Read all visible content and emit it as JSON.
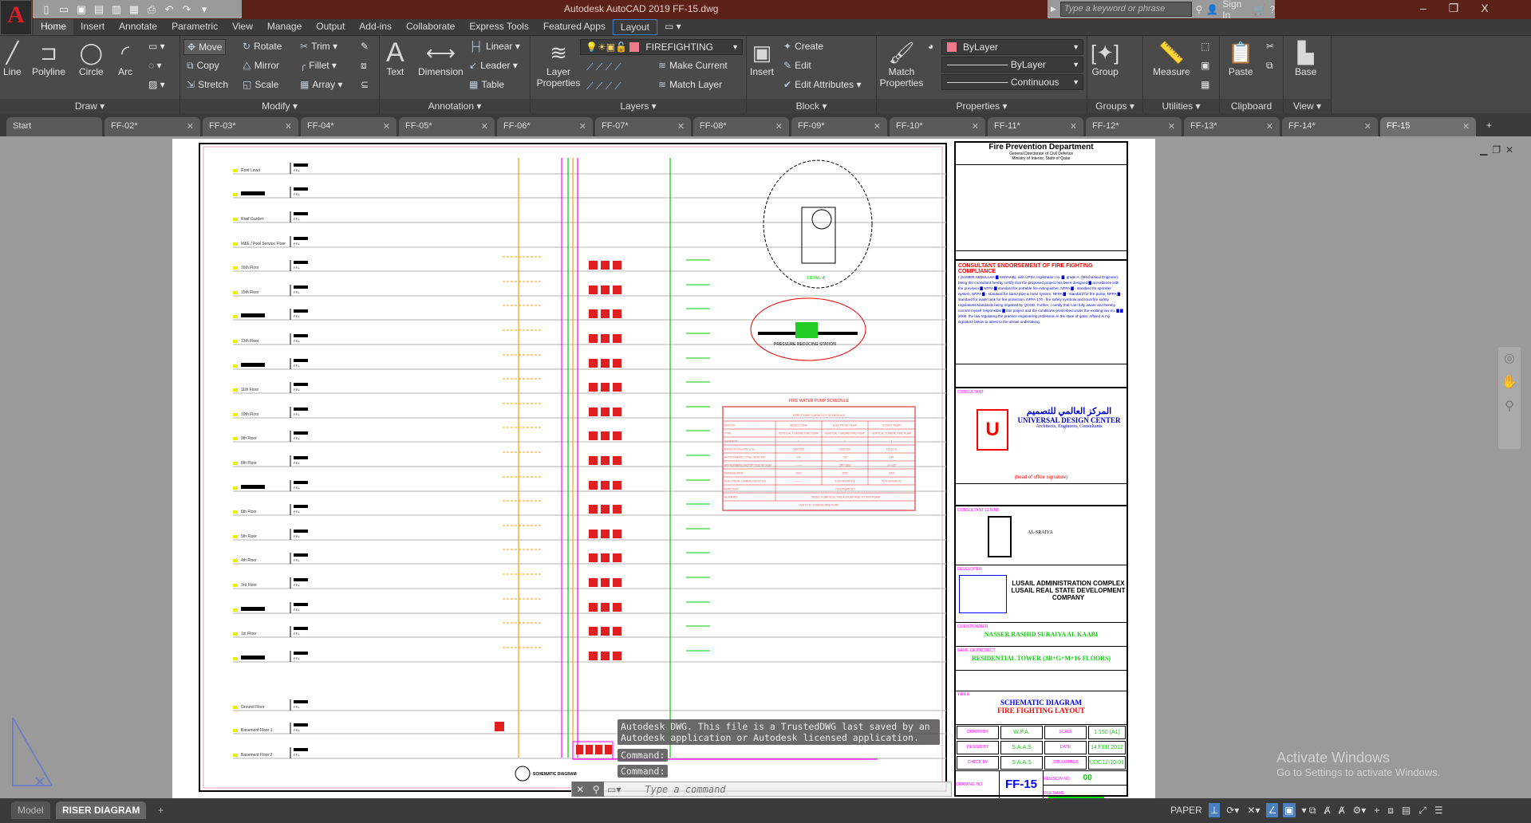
{
  "app": {
    "title": "Autodesk AutoCAD 2019    FF-15.dwg",
    "logo": "A"
  },
  "qat": [
    "new-icon",
    "open-icon",
    "save-icon",
    "save-as-icon",
    "open-web-icon",
    "save-web-icon",
    "plot-icon",
    "undo-icon",
    "redo-icon",
    "customize-icon"
  ],
  "search": {
    "placeholder": "Type a keyword or phrase",
    "sign_in": "Sign In"
  },
  "window": {
    "minimize": "–",
    "restore": "❐",
    "close": "X"
  },
  "ribbon_tabs": [
    "Home",
    "Insert",
    "Annotate",
    "Parametric",
    "View",
    "Manage",
    "Output",
    "Add-ins",
    "Collaborate",
    "Express Tools",
    "Featured Apps",
    "Layout",
    "▭ ▾"
  ],
  "ribbon": {
    "draw": {
      "title": "Draw ▾",
      "line": "Line",
      "polyline": "Polyline",
      "circle": "Circle",
      "arc": "Arc"
    },
    "modify": {
      "title": "Modify ▾",
      "move": "Move",
      "rotate": "Rotate",
      "trim": "Trim",
      "copy": "Copy",
      "mirror": "Mirror",
      "fillet": "Fillet",
      "stretch": "Stretch",
      "scale": "Scale",
      "array": "Array"
    },
    "annotation": {
      "title": "Annotation ▾",
      "text": "Text",
      "dimension": "Dimension",
      "linear": "Linear",
      "leader": "Leader",
      "table": "Table"
    },
    "layers": {
      "title": "Layers ▾",
      "layer_properties": "Layer Properties",
      "current_layer": "FIREFIGHTING",
      "make_current": "Make Current",
      "match_layer": "Match Layer"
    },
    "block": {
      "title": "Block ▾",
      "insert": "Insert",
      "create": "Create",
      "edit": "Edit",
      "edit_attributes": "Edit Attributes"
    },
    "properties": {
      "title": "Properties ▾",
      "match_properties": "Match Properties",
      "color": "ByLayer",
      "lineweight": "ByLayer",
      "linetype": "Continuous"
    },
    "groups": {
      "title": "Groups ▾",
      "group": "Group"
    },
    "utilities": {
      "title": "Utilities ▾",
      "measure": "Measure"
    },
    "clipboard": {
      "title": "Clipboard",
      "paste": "Paste"
    },
    "view": {
      "title": "View ▾",
      "base": "Base"
    }
  },
  "colors": {
    "layer_color": "#f07a8a",
    "title_bar": "#5c2117"
  },
  "file_tabs": [
    {
      "label": "Start"
    },
    {
      "label": "FF-02*"
    },
    {
      "label": "FF-03*"
    },
    {
      "label": "FF-04*"
    },
    {
      "label": "FF-05*"
    },
    {
      "label": "FF-06*"
    },
    {
      "label": "FF-07*"
    },
    {
      "label": "FF-08*"
    },
    {
      "label": "FF-09*"
    },
    {
      "label": "FF-10*"
    },
    {
      "label": "FF-11*"
    },
    {
      "label": "FF-12*"
    },
    {
      "label": "FF-13*"
    },
    {
      "label": "FF-14*"
    },
    {
      "label": "FF-15",
      "active": true
    }
  ],
  "drawing": {
    "floors": [
      "Roof Level",
      "",
      "Roof Garden",
      "M&E / Pool Service Floor",
      "16th Floor",
      "15th Floor",
      "",
      "13th Floor",
      "",
      "11th Floor",
      "10th Floor",
      "9th Floor",
      "8th Floor",
      "",
      "6th Floor",
      "5th Floor",
      "4th Floor",
      "3rd Floor",
      "",
      "1st Floor",
      "",
      "Ground Floor",
      "Basement Floor 1",
      "Basement Floor 2"
    ],
    "ffl": "F.F.L.",
    "detail_label": "DETAIL-A",
    "prs_label": "PRESSURE REDUCING STATION",
    "schematic_label": "SCHEMATIC DIAGRAM",
    "pump_schedule": {
      "title": "FIRE WATER PUMP SCHEDULE",
      "subtitle": "FIRE PUMP CAPACITY SCHEDULE",
      "header": [
        "UNIT NO.",
        "DIESEL PUMP",
        "ELECTRICAL PUMP",
        "JOCKEY PUMP"
      ],
      "rows": [
        [
          "TYPE",
          "VERTICAL TURBINE FIRE PUMP",
          "VERTICAL TURBINE FIRE PUMP",
          "VERTICAL TURBINE FIRE PUMP"
        ],
        [
          "QUANTITY",
          "1",
          "1",
          "1"
        ],
        [
          "RATED FLOW GPM (L/S)",
          "1500 (95)",
          "1500 (95)",
          "100 (6.3)"
        ],
        [
          "APPROXIMATE TOTAL HEAD PSI",
          "140",
          "140",
          "150"
        ],
        [
          "APPROXIMATE MOTOR SIZE HP (KW)",
          "———",
          "250 (186)",
          "20 (15)"
        ],
        [
          "MINIMUM RPM",
          "2950",
          "2950",
          "2900"
        ],
        [
          "ELECTRICAL CHARACTERISTICS",
          "———",
          "415V/3PH/50 HZ",
          "415V/3PH/50 HZ"
        ]
      ],
      "function": [
        "FUNCTION",
        "FIRE PUMP SET"
      ],
      "remarks": [
        "REMARKS",
        "DIESEL PUMP, ELECTRICAL PUMP AND JOCKEY PUMP."
      ],
      "footer": "VERTICAL TURBINE FIRE PUMP"
    }
  },
  "title_block": {
    "dept": "Fire Prevention Department",
    "dept_sub1": "General Directorate of Civil Defence",
    "dept_sub2": "Ministry of Interior, State of Qatar",
    "endorse_title": "CONSULTANT ENDORSEMENT OF FIRE FIGHTING COMPLIANCE",
    "endorse_text": "I (SAMER ABDULLAH ▇ SHAHAB), with UPDA registration no. ▇, grade A, (Mechanical Engineer), being the consultant hereby certify that the proposed project has been designed ▇ accordance with the provision ▇ NFPA ▇ standard for portable fire extinguisher, NFPA ▇ - standard for sprinkler system, NFPA ▇ - standard for stand pipe & hose system, NFPA ▇ - standard for fire pump, NFPA ▇ - standard for water tank for fire protection, NFPA 170 - fire safety symbols and local fire safety regulations/standards being imposed by QCDD. Further, I certify that I am fully aware and hereby commit myself responsible ▇ this project and the conditions prescribed under the existing law no. ▇ ▇ 2005, the law regulating the practice engineering profession in the state of qatar. Affixed is my signature below to attest to the above undertaking.",
    "consultant_label": "CONSULTANT",
    "company_ar": "المركز العالمي للتصميم",
    "company": "UNIVERSAL DESIGN CENTER",
    "company_sub": "Architects, Engineers, Consultants",
    "signature_note": "(head of office signature)",
    "client_label": "CONSULTANT CLIENT",
    "client_name": "AL-SRAIYA",
    "developer_label": "DEVELOPER",
    "developer": "LUSAIL ADMINISTRATION COMPLEX LUSAIL REAL STATE DEVELOPMENT COMPANY",
    "owner_label": "CLIENT/OWNER",
    "owner": "NASSER RASHID SURAIYA AL KAABI",
    "project_label": "NAME OF PROJECT",
    "project": "RESIDENTIAL TOWER (3B+G+M+16 FLOORS)",
    "title_label": "TITLE",
    "title1": "SCHEMATIC DIAGRAM",
    "title2": "FIRE FIGHTING LAYOUT",
    "grid": [
      [
        "DRAWN BY",
        "W.P.A.",
        "SCALE",
        "1:150 (A1)"
      ],
      [
        "DESIGN BY",
        "S.A.A.S",
        "DATE",
        "14 FEB 2012"
      ],
      [
        "CHECK BY",
        "S.A.A.S",
        "JOB NUMBER",
        "UDC12-10-01"
      ]
    ],
    "drawing_no_label": "DRAWING NO.",
    "drawing_no": "FF-15",
    "revision_label": "REVISION NO.",
    "revision": "00",
    "file_name_label": "FILE NAME"
  },
  "command": {
    "message": "Autodesk DWG.  This file is a TrustedDWG last saved by an Autodesk application or Autodesk licensed application.",
    "history": [
      "Command:",
      "Command:"
    ],
    "placeholder": "Type a command"
  },
  "layout_tabs": [
    "Model",
    "RISER DIAGRAM",
    "+"
  ],
  "status": {
    "paper": "PAPER"
  },
  "watermark": {
    "line1": "Activate Windows",
    "line2": "Go to Settings to activate Windows."
  }
}
